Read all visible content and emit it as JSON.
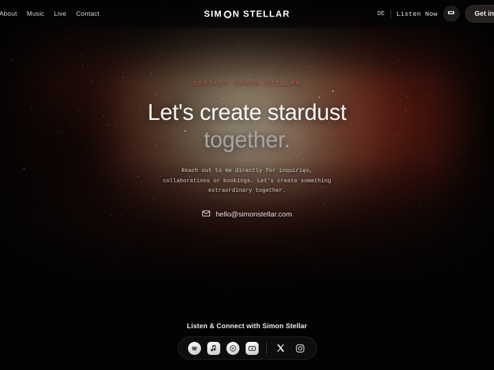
{
  "header": {
    "nav_items": [
      {
        "label": "About"
      },
      {
        "label": "Music"
      },
      {
        "label": "Live"
      },
      {
        "label": "Contact"
      }
    ],
    "logo": {
      "text_before": "SIM",
      "text_after": "N STELLAR",
      "eclipse_icon": "eclipse-circle-icon"
    },
    "language": "DE",
    "listen_now": "Listen Now",
    "ticket_button_icon": "ticket-icon",
    "cta_label": "Get in"
  },
  "hero": {
    "eyebrow": "CONTACT SIMON STELLAR",
    "headline_line1": "Let's create stardust",
    "headline_line2": "together.",
    "lede": "Reach out to me directly for inquiries, collaborations or bookings. Let's create something extraordinary together.",
    "email": "hello@simonstellar.com",
    "email_icon": "envelope-icon"
  },
  "footer": {
    "title": "Listen & Connect with Simon Stellar",
    "socials": [
      {
        "name": "spotify-icon",
        "label": "Spotify",
        "style": "filled-circle"
      },
      {
        "name": "apple-music-icon",
        "label": "Apple Music",
        "style": "filled-square"
      },
      {
        "name": "amazon-music-icon",
        "label": "Amazon Music",
        "style": "filled-circle"
      },
      {
        "name": "youtube-icon",
        "label": "YouTube",
        "style": "filled-square"
      },
      {
        "name": "x-twitter-icon",
        "label": "X",
        "style": "outline"
      },
      {
        "name": "instagram-icon",
        "label": "Instagram",
        "style": "outline"
      }
    ]
  },
  "colors": {
    "accent_red": "#c3564a",
    "background": "#030202",
    "text_primary": "#f7f5f3",
    "text_muted": "#a9a3a0"
  }
}
